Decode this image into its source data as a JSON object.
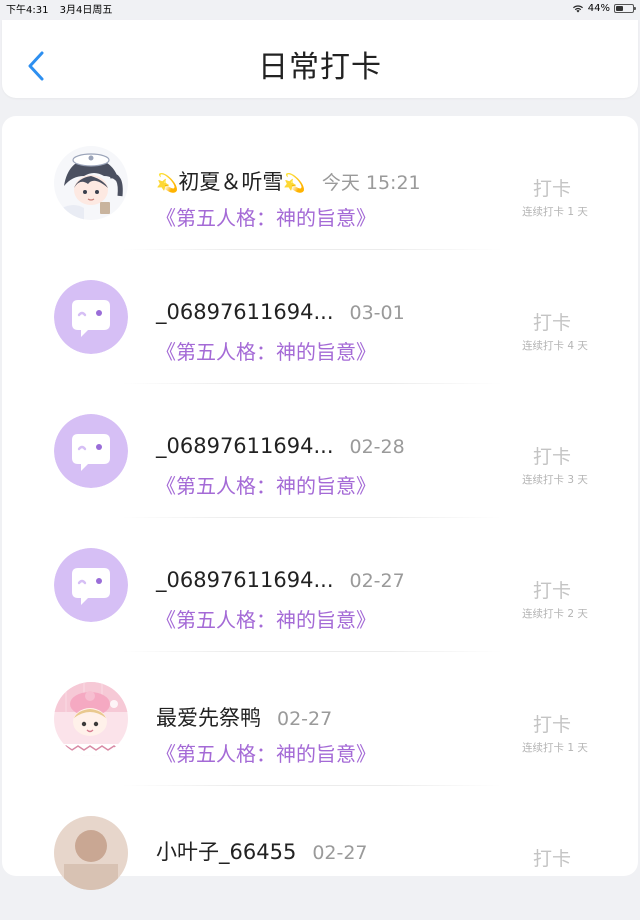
{
  "status_bar": {
    "time": "下午4:31",
    "date": "3月4日周五",
    "battery": "44%",
    "battery_level": 0.44
  },
  "header": {
    "title": "日常打卡"
  },
  "entries": [
    {
      "name": "初夏＆听雪",
      "sparkle": "💫",
      "date": "今天 15:21",
      "book": "《第五人格：神的旨意》",
      "checkin_label": "打卡",
      "streak": "连续打卡 1 天",
      "avatar": "anime-avatar"
    },
    {
      "name": "_06897611694...",
      "date": "03-01",
      "book": "《第五人格：神的旨意》",
      "checkin_label": "打卡",
      "streak": "连续打卡 4 天",
      "avatar": "default-chat-avatar"
    },
    {
      "name": "_06897611694...",
      "date": "02-28",
      "book": "《第五人格：神的旨意》",
      "checkin_label": "打卡",
      "streak": "连续打卡 3 天",
      "avatar": "default-chat-avatar"
    },
    {
      "name": "_06897611694...",
      "date": "02-27",
      "book": "《第五人格：神的旨意》",
      "checkin_label": "打卡",
      "streak": "连续打卡 2 天",
      "avatar": "default-chat-avatar"
    },
    {
      "name": "最爱先祭鸭",
      "date": "02-27",
      "book": "《第五人格：神的旨意》",
      "checkin_label": "打卡",
      "streak": "连续打卡 1 天",
      "avatar": "anime-avatar-pink"
    },
    {
      "name": "小叶子_66455",
      "date": "02-27",
      "checkin_label": "打卡",
      "avatar": "photo-avatar"
    }
  ],
  "colors": {
    "accent_blue": "#2d8ff0",
    "book_purple": "#a46ad6",
    "avatar_purple": "#d6bff5"
  }
}
